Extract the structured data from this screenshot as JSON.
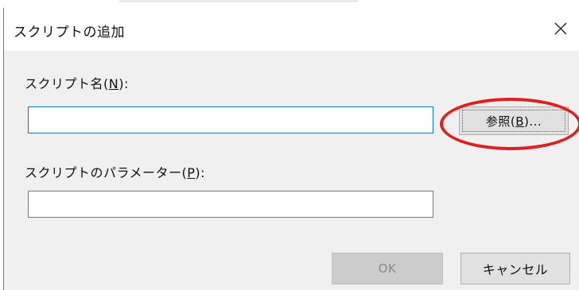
{
  "dialog": {
    "title": "スクリプトの追加",
    "close_icon": "close-icon"
  },
  "script_name": {
    "label_prefix": "スクリプト名(",
    "label_key": "N",
    "label_suffix": "):",
    "value": ""
  },
  "browse_button": {
    "label_prefix": "参照(",
    "label_key": "B",
    "label_suffix": ")..."
  },
  "script_params": {
    "label_prefix": "スクリプトのパラメーター(",
    "label_key": "P",
    "label_suffix": "):",
    "value": ""
  },
  "buttons": {
    "ok": "OK",
    "cancel": "キャンセル"
  },
  "colors": {
    "annotation": "#e02020",
    "focus_border": "#0078d7"
  }
}
